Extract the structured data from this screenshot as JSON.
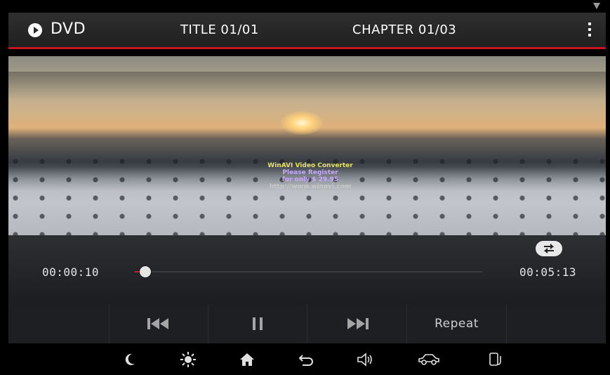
{
  "header": {
    "source_label": "DVD",
    "title_label": "TITLE 01/01",
    "chapter_label": "CHAPTER 01/03",
    "accent_color": "#c8141e"
  },
  "video": {
    "watermark_lines": [
      "WinAVI Video Converter",
      "Please Register",
      "for only $ 29.95",
      "http://www.winavi.com"
    ]
  },
  "playback": {
    "current_time": "00:00:10",
    "total_time": "00:05:13",
    "progress_fraction": 0.03
  },
  "controls": {
    "prev_icon": "skip-previous-icon",
    "pause_icon": "pause-icon",
    "next_icon": "skip-next-icon",
    "repeat_label": "Repeat"
  },
  "nav": {
    "items": [
      "moon-icon",
      "brightness-icon",
      "home-icon",
      "back-icon",
      "volume-icon",
      "car-icon",
      "phone-icon"
    ]
  }
}
